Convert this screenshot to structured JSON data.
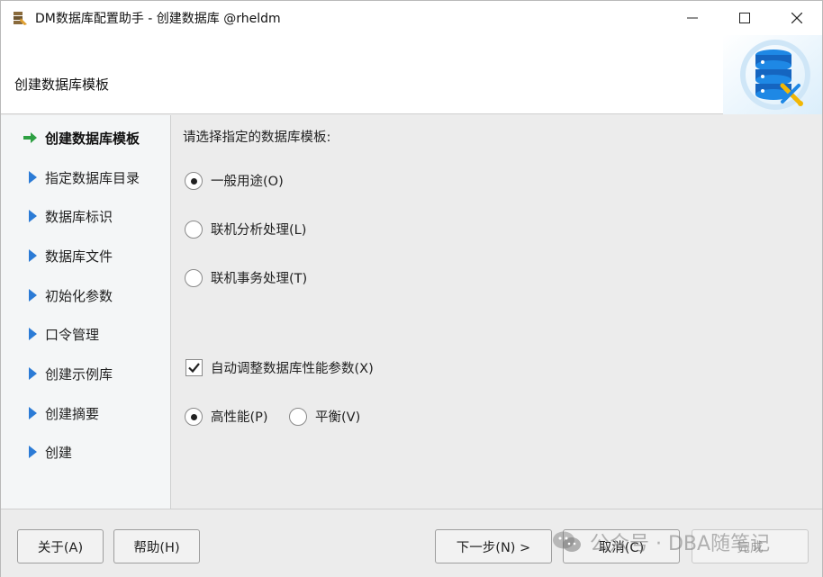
{
  "window": {
    "title": "DM数据库配置助手 - 创建数据库 @rheldm"
  },
  "banner": {
    "title": "创建数据库模板"
  },
  "sidebar": {
    "items": [
      {
        "label": "创建数据库模板",
        "active": true,
        "icon": "green-arrow-icon"
      },
      {
        "label": "指定数据库目录",
        "active": false,
        "icon": "blue-triangle-icon"
      },
      {
        "label": "数据库标识",
        "active": false,
        "icon": "blue-triangle-icon"
      },
      {
        "label": "数据库文件",
        "active": false,
        "icon": "blue-triangle-icon"
      },
      {
        "label": "初始化参数",
        "active": false,
        "icon": "blue-triangle-icon"
      },
      {
        "label": "口令管理",
        "active": false,
        "icon": "blue-triangle-icon"
      },
      {
        "label": "创建示例库",
        "active": false,
        "icon": "blue-triangle-icon"
      },
      {
        "label": "创建摘要",
        "active": false,
        "icon": "blue-triangle-icon"
      },
      {
        "label": "创建",
        "active": false,
        "icon": "blue-triangle-icon"
      }
    ]
  },
  "main": {
    "prompt": "请选择指定的数据库模板:",
    "templates": [
      {
        "label": "一般用途(O)",
        "checked": true
      },
      {
        "label": "联机分析处理(L)",
        "checked": false
      },
      {
        "label": "联机事务处理(T)",
        "checked": false
      }
    ],
    "auto_tune": {
      "label": "自动调整数据库性能参数(X)",
      "checked": true
    },
    "performance": [
      {
        "label": "高性能(P)",
        "checked": true
      },
      {
        "label": "平衡(V)",
        "checked": false
      }
    ]
  },
  "footer": {
    "about": "关于(A)",
    "help": "帮助(H)",
    "next": "下一步(N) >",
    "cancel": "取消(C)",
    "finish": "完成",
    "watermark": "公众号 · DBA随笔记"
  },
  "colors": {
    "active_arrow": "#2ea043",
    "nav_triangle": "#2b7bd6",
    "banner_art": "#1e88e5"
  }
}
